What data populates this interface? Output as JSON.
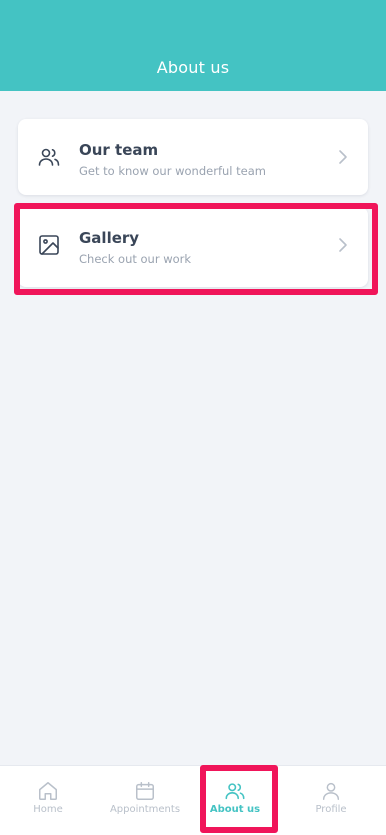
{
  "header": {
    "title": "About us"
  },
  "cards": [
    {
      "title": "Our team",
      "subtitle": "Get to know our wonderful team",
      "icon": "users-icon"
    },
    {
      "title": "Gallery",
      "subtitle": "Check out our work",
      "icon": "image-icon"
    }
  ],
  "tabs": [
    {
      "label": "Home",
      "icon": "home-icon",
      "active": false
    },
    {
      "label": "Appointments",
      "icon": "calendar-icon",
      "active": false
    },
    {
      "label": "About us",
      "icon": "users-icon",
      "active": true
    },
    {
      "label": "Profile",
      "icon": "user-icon",
      "active": false
    }
  ],
  "colors": {
    "accent": "#44c3c3",
    "highlight": "#f0155a",
    "text": "#3a4658",
    "muted": "#9aa3b0"
  }
}
